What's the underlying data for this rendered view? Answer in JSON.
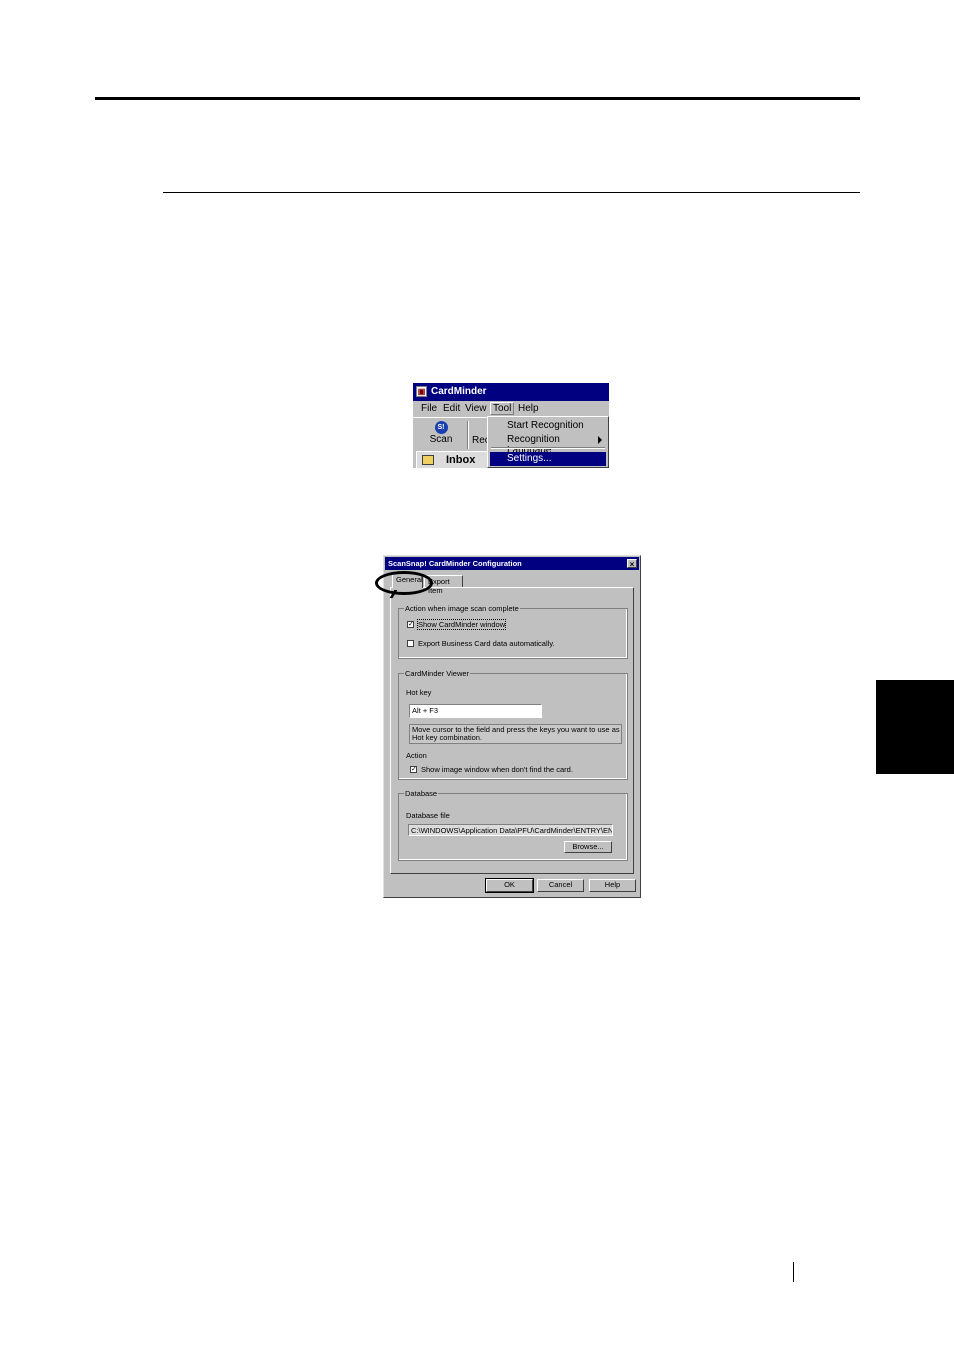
{
  "cardminder_window": {
    "title": "CardMinder",
    "menu": [
      "File",
      "Edit",
      "View",
      "Tool",
      "Help"
    ],
    "toolbar": {
      "scan_label": "Scan",
      "rec_label": "Rec"
    },
    "inbox_label": "Inbox",
    "tool_menu": {
      "items": [
        "Start Recognition",
        "Recognition Language",
        "Settings..."
      ],
      "selected": "Settings..."
    }
  },
  "config_dialog": {
    "title": "ScanSnap! CardMinder Configuration",
    "close_glyph": "×",
    "tabs": [
      "General",
      "Export Item"
    ],
    "action_group": {
      "label": "Action when image scan complete",
      "show_window": {
        "label": "Show CardMinder window",
        "checked": true
      },
      "export_auto": {
        "label": "Export Business Card data automatically.",
        "checked": false
      }
    },
    "viewer_group": {
      "label": "CardMinder Viewer",
      "hotkey_label": "Hot key",
      "hotkey_value": "Alt + F3",
      "hint": "Move cursor to the field and press the keys you want to use as Hot key combination.",
      "action_label": "Action",
      "show_image": {
        "label": "Show image window when don't find the card.",
        "checked": true
      }
    },
    "database_group": {
      "label": "Database",
      "file_label": "Database file",
      "file_path": "C:\\WINDOWS\\Application Data\\PFU\\CardMinder\\ENTRY\\ENT",
      "browse_label": "Browse..."
    },
    "buttons": {
      "ok": "OK",
      "cancel": "Cancel",
      "help": "Help"
    }
  }
}
